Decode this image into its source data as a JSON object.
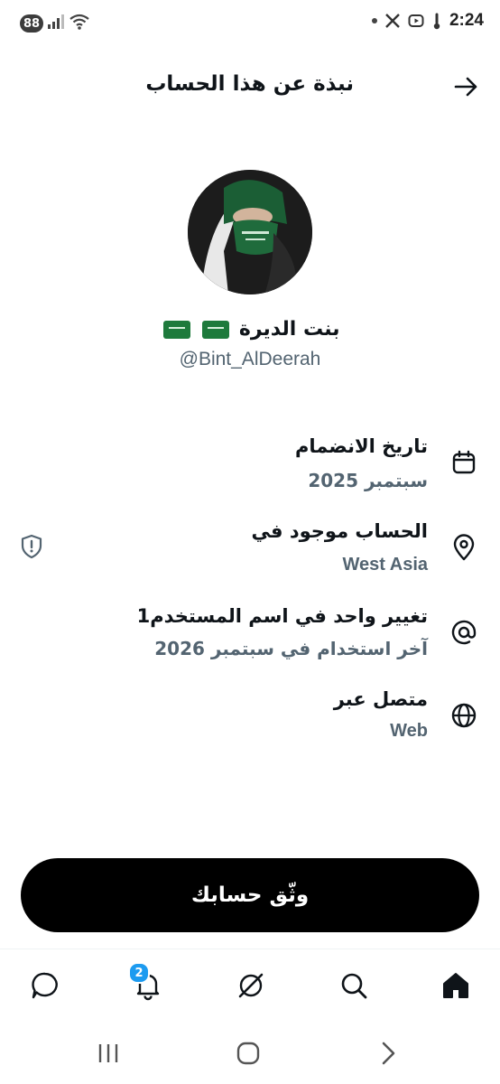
{
  "status_bar": {
    "battery": "88",
    "time": "2:24"
  },
  "header": {
    "title": "نبذة عن هذا الحساب",
    "back_icon": "arrow-right-icon"
  },
  "profile": {
    "display_name": "بنت الديرة",
    "handle": "@Bint_AlDeerah"
  },
  "info": [
    {
      "icon": "calendar-icon",
      "label": "تاريخ الانضمام",
      "value": "سبتمبر 2025"
    },
    {
      "icon": "location-pin-icon",
      "label": "الحساب موجود في",
      "value": "West Asia",
      "extra_icon": "shield-alert-icon"
    },
    {
      "icon": "at-sign-icon",
      "label": "تغيير واحد في اسم المستخدم1",
      "value": "آخر استخدام في سبتمبر 2026"
    },
    {
      "icon": "globe-icon",
      "label": "متصل عبر",
      "value": "Web"
    }
  ],
  "verify_button": {
    "label": "وثّق حسابك"
  },
  "bottom_nav": {
    "items": [
      "home-icon",
      "search-icon",
      "grok-icon",
      "notifications-icon",
      "messages-icon"
    ],
    "notification_badge": "2"
  },
  "colors": {
    "text_primary": "#0f1419",
    "text_secondary": "#536471",
    "accent": "#1d9bf0",
    "button_bg": "#000000"
  }
}
